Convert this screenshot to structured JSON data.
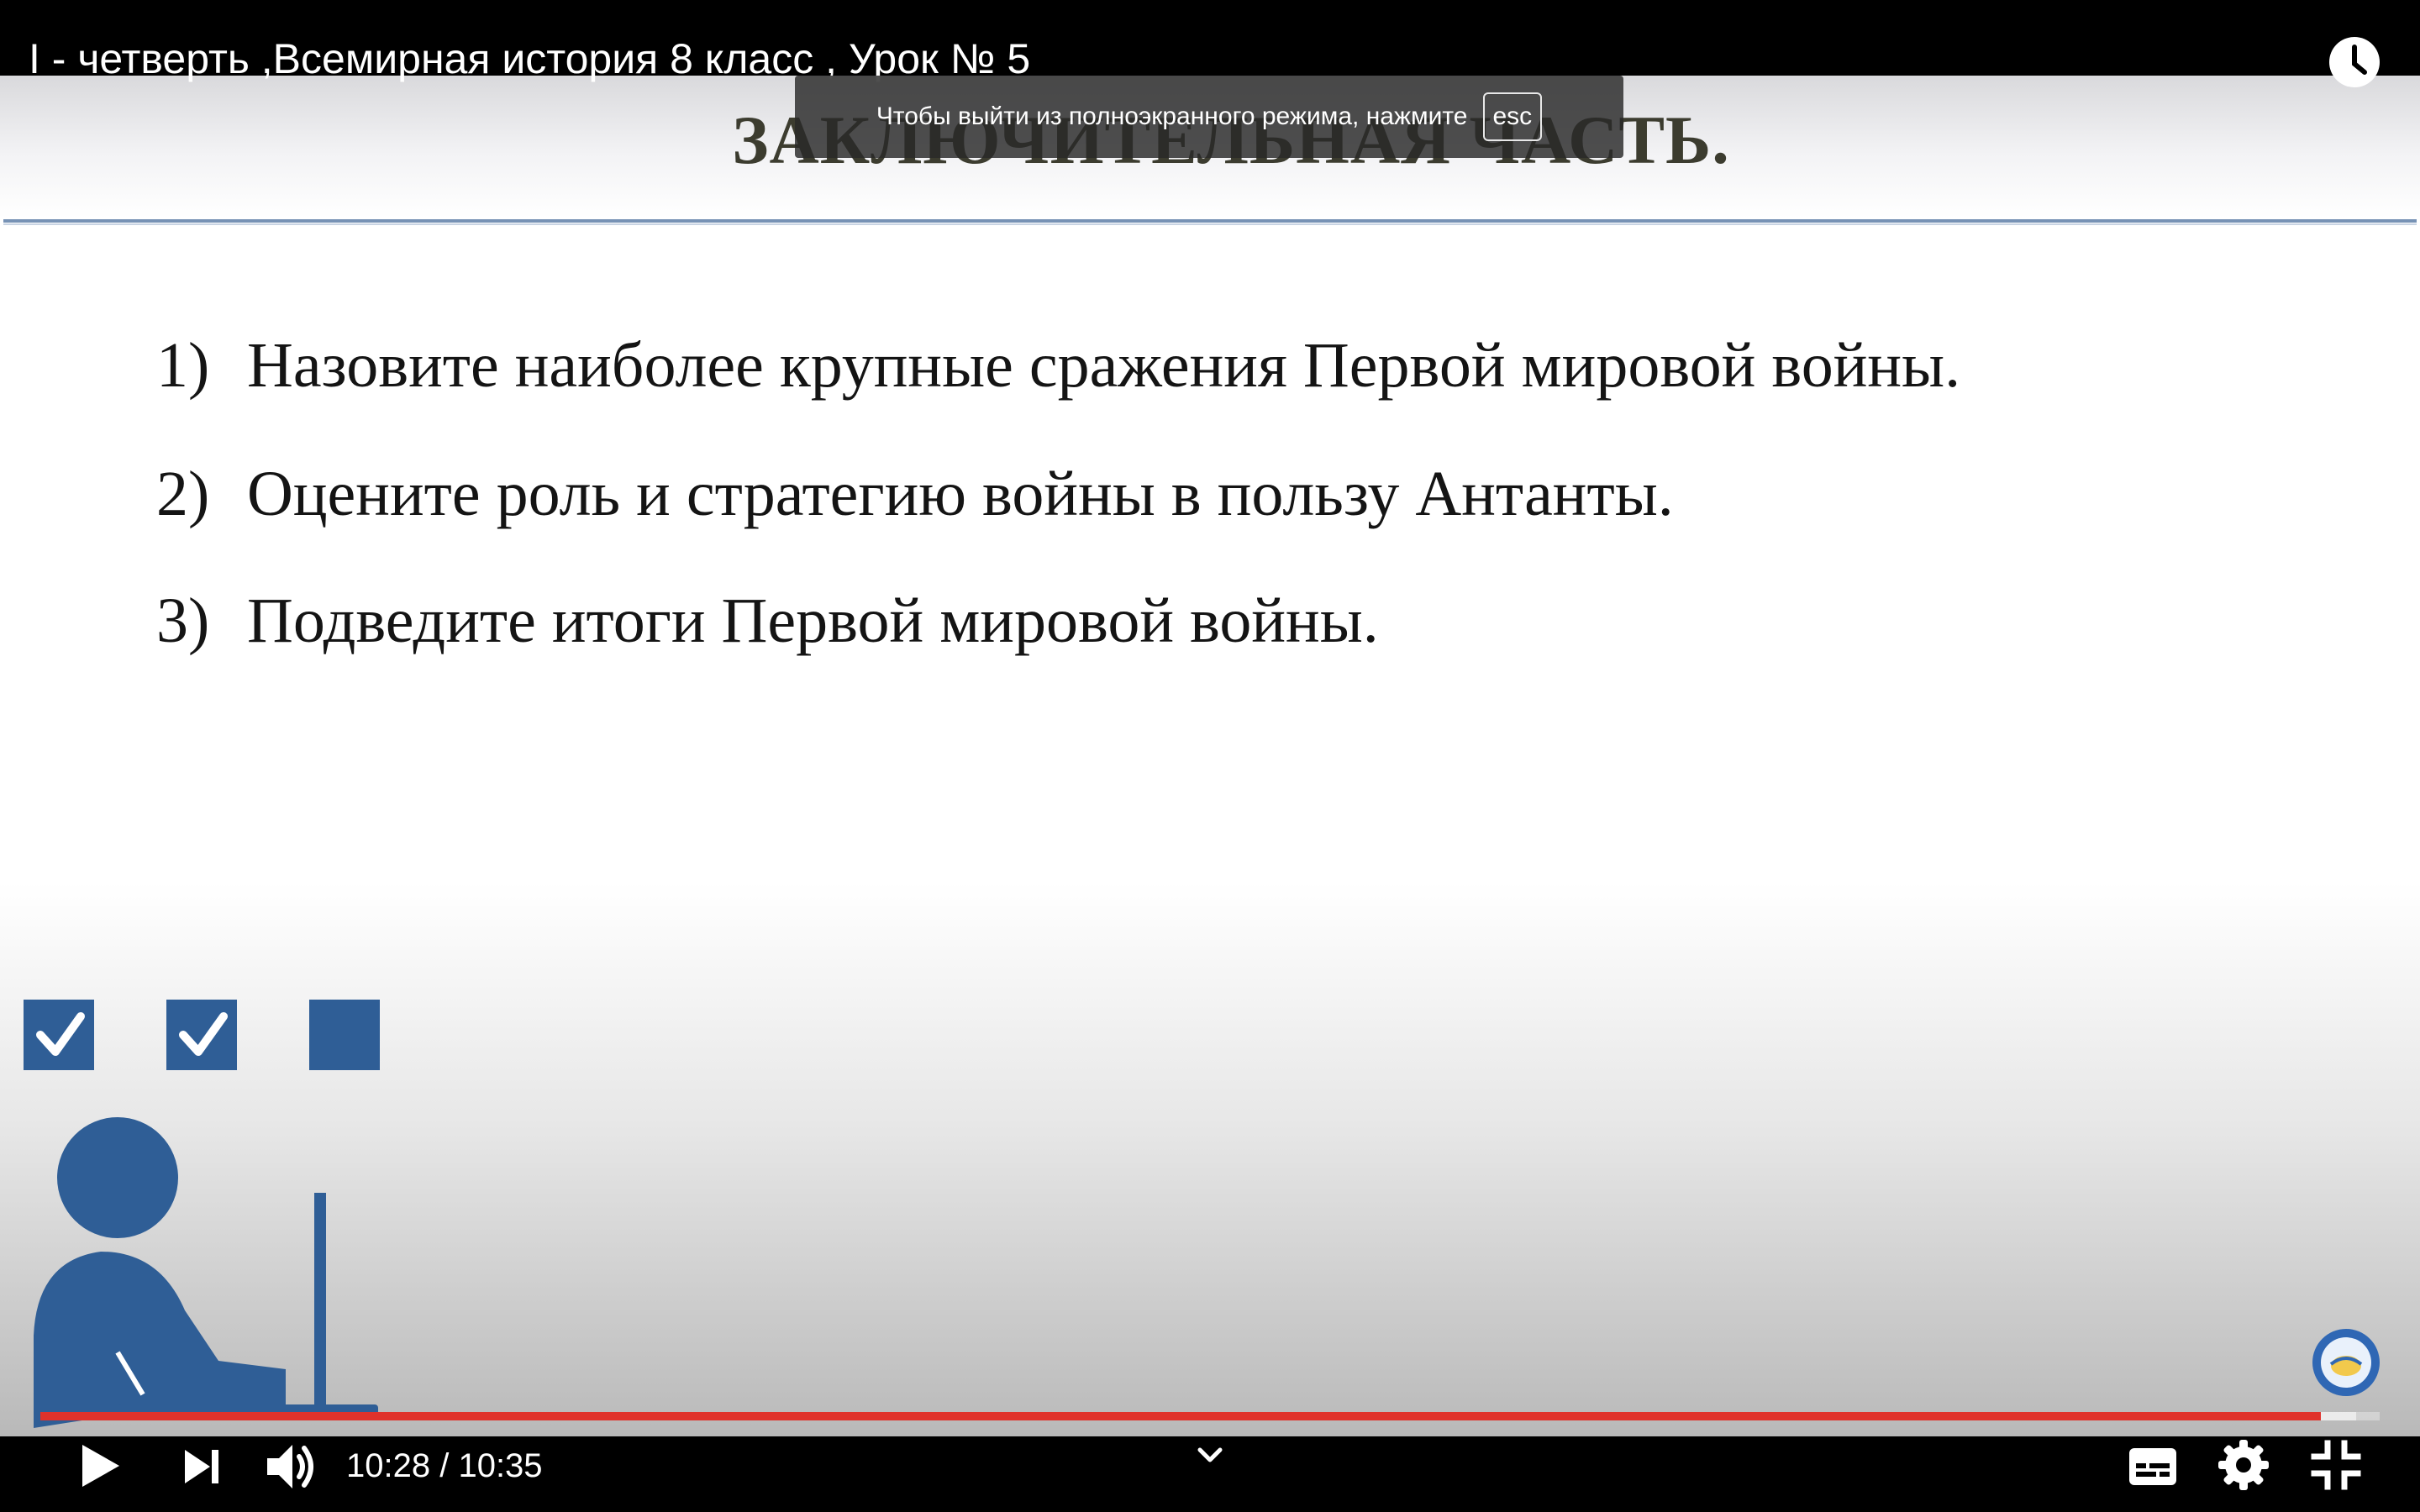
{
  "player": {
    "title": "I - четверть ,Всемирная история 8 класс , Урок № 5",
    "time_current": "10:28",
    "time_total": "10:35",
    "time_separator": " / ",
    "progress_fraction": 0.975,
    "buffered_fraction": 0.99,
    "progress_color": "#e0322b"
  },
  "fullscreen_toast": {
    "text": "Чтобы выйти из полноэкранного режима, нажмите",
    "key": "esc"
  },
  "slide": {
    "title": "ЗАКЛЮЧИТЕЛЬНАЯ ЧАСТЬ.",
    "questions": [
      {
        "num": "1)",
        "text": "Назовите наиболее крупные сражения Первой мировой войны."
      },
      {
        "num": "2)",
        "text": "Оцените роль и стратегию войны в пользу Антанты."
      },
      {
        "num": "3)",
        "text": "Подведите итоги Первой мировой войны."
      }
    ],
    "accent_color": "#2f5e96"
  },
  "icons": {
    "watch_later": "clock-icon",
    "play": "play-icon",
    "next": "next-icon",
    "volume": "volume-icon",
    "chevron": "chevron-down-icon",
    "subtitles": "subtitles-icon",
    "settings": "gear-icon",
    "exit_fullscreen": "exit-fullscreen-icon"
  }
}
